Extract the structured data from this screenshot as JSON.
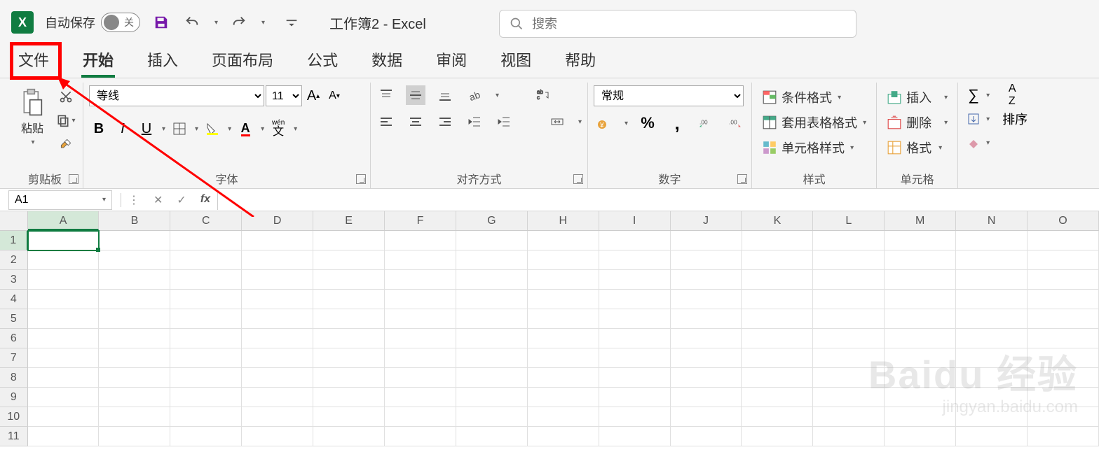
{
  "titlebar": {
    "autosave_label": "自动保存",
    "autosave_state": "关",
    "doc_title": "工作簿2 - Excel"
  },
  "search": {
    "placeholder": "搜索"
  },
  "tabs": {
    "file": "文件",
    "home": "开始",
    "insert": "插入",
    "layout": "页面布局",
    "formulas": "公式",
    "data": "数据",
    "review": "审阅",
    "view": "视图",
    "help": "帮助"
  },
  "ribbon": {
    "clipboard": {
      "paste": "粘贴",
      "label": "剪贴板"
    },
    "font": {
      "name": "等线",
      "size": "11",
      "label": "字体",
      "phonetic": "wén",
      "phonetic2": "文"
    },
    "align": {
      "label": "对齐方式"
    },
    "number": {
      "format": "常规",
      "label": "数字"
    },
    "styles": {
      "cond": "条件格式",
      "table": "套用表格格式",
      "cell": "单元格样式",
      "label": "样式"
    },
    "cells": {
      "insert": "插入",
      "delete": "删除",
      "format": "格式",
      "label": "单元格"
    },
    "editing": {
      "sort": "排序"
    }
  },
  "namebox": {
    "ref": "A1"
  },
  "columns": [
    "A",
    "B",
    "C",
    "D",
    "E",
    "F",
    "G",
    "H",
    "I",
    "J",
    "K",
    "L",
    "M",
    "N",
    "O"
  ],
  "rows": [
    "1",
    "2",
    "3",
    "4",
    "5",
    "6",
    "7",
    "8",
    "9",
    "10",
    "11"
  ],
  "watermark": {
    "line1": "Baidu 经验",
    "line2": "jingyan.baidu.com"
  }
}
